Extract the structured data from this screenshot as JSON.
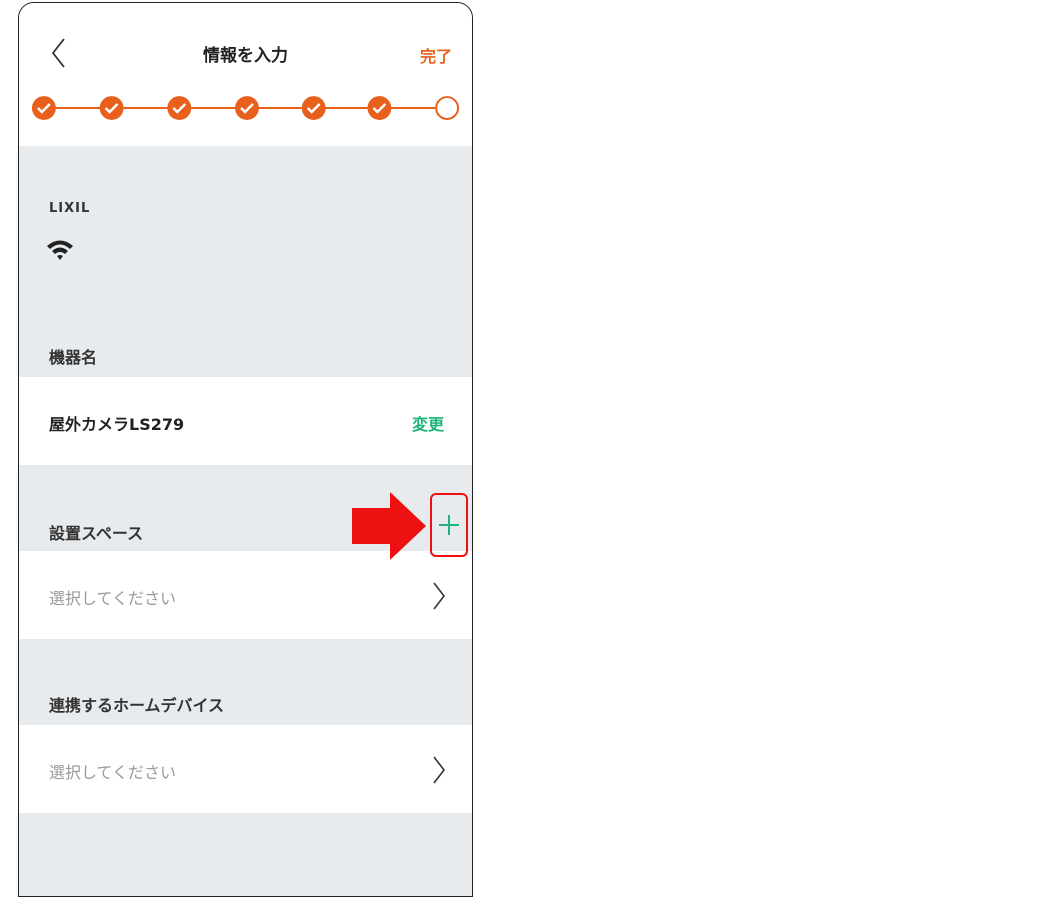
{
  "header": {
    "title": "情報を入力",
    "done_label": "完了"
  },
  "stepper": {
    "completed_steps": 6,
    "total_steps": 7,
    "accent_color": "#e8601c"
  },
  "device": {
    "brand": "LIXIL",
    "connection_icon": "wifi-icon"
  },
  "device_name": {
    "label": "機器名",
    "value": "屋外カメラLS279",
    "change_label": "変更"
  },
  "install_space": {
    "label": "設置スペース",
    "placeholder": "選択してください",
    "add_icon": "plus-icon"
  },
  "home_devices": {
    "label": "連携するホームデバイス",
    "placeholder": "選択してください"
  },
  "annotation": {
    "arrow_color": "#ee1111",
    "highlight": "plus-icon"
  },
  "colors": {
    "accent_orange": "#e8601c",
    "accent_green": "#1db37a",
    "background": "#e8ebee"
  }
}
